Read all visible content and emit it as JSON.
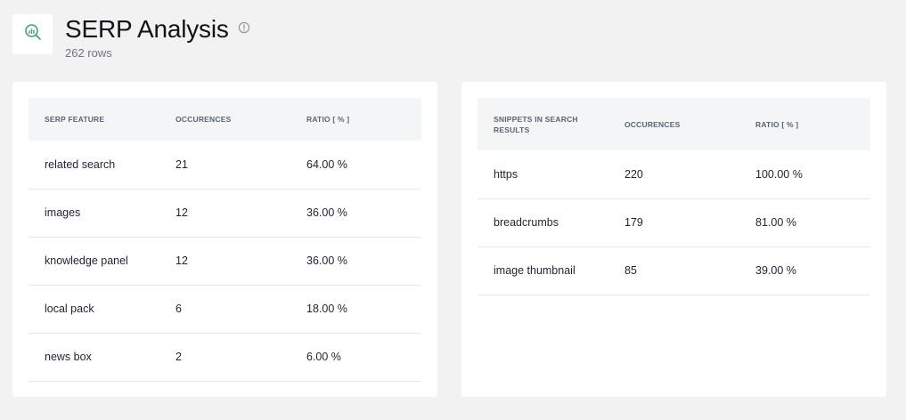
{
  "page": {
    "title": "SERP Analysis",
    "row_count": "262 rows",
    "logo_icon": "chart-magnifier-icon",
    "info_icon": "info-icon",
    "accent_color": "#3aa56b"
  },
  "serp_features": {
    "columns": [
      "SERP FEATURE",
      "OCCURENCES",
      "RATIO [ % ]"
    ],
    "rows": [
      {
        "feature": "related search",
        "occurences": "21",
        "ratio": "64.00 %"
      },
      {
        "feature": "images",
        "occurences": "12",
        "ratio": "36.00 %"
      },
      {
        "feature": "knowledge panel",
        "occurences": "12",
        "ratio": "36.00 %"
      },
      {
        "feature": "local pack",
        "occurences": "6",
        "ratio": "18.00 %"
      },
      {
        "feature": "news box",
        "occurences": "2",
        "ratio": "6.00 %"
      }
    ]
  },
  "snippets": {
    "columns": [
      "SNIPPETS IN SEARCH RESULTS",
      "OCCURENCES",
      "RATIO [ % ]"
    ],
    "rows": [
      {
        "snippet": "https",
        "occurences": "220",
        "ratio": "100.00 %"
      },
      {
        "snippet": "breadcrumbs",
        "occurences": "179",
        "ratio": "81.00 %"
      },
      {
        "snippet": "image thumbnail",
        "occurences": "85",
        "ratio": "39.00 %"
      }
    ]
  }
}
